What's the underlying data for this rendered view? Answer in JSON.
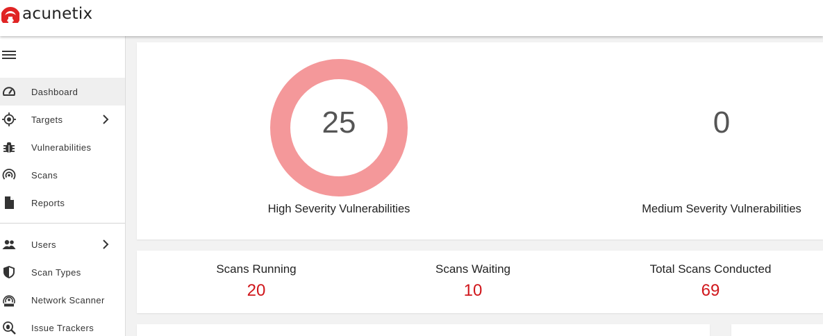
{
  "app": {
    "brand": "acunetix",
    "brand_color": "#e02424"
  },
  "sidebar": {
    "menu_icon": "hamburger-icon",
    "items": [
      {
        "label": "Dashboard",
        "icon": "speedometer-icon",
        "active": true
      },
      {
        "label": "Targets",
        "icon": "crosshair-icon",
        "has_submenu": true
      },
      {
        "label": "Vulnerabilities",
        "icon": "bug-icon"
      },
      {
        "label": "Scans",
        "icon": "radar-icon"
      },
      {
        "label": "Reports",
        "icon": "document-icon"
      },
      {
        "label": "Users",
        "icon": "users-icon",
        "has_submenu": true
      },
      {
        "label": "Scan Types",
        "icon": "shield-icon"
      },
      {
        "label": "Network Scanner",
        "icon": "network-scanner-icon"
      },
      {
        "label": "Issue Trackers",
        "icon": "issue-tracker-icon"
      }
    ]
  },
  "severity": {
    "high": {
      "count": "25",
      "label": "High Severity Vulnerabilities",
      "color": "#f4989a"
    },
    "medium": {
      "count": "0",
      "label": "Medium Severity Vulnerabilities"
    }
  },
  "stats": {
    "running": {
      "label": "Scans Running",
      "value": "20"
    },
    "waiting": {
      "label": "Scans Waiting",
      "value": "10"
    },
    "total": {
      "label": "Total Scans Conducted",
      "value": "69"
    },
    "value_color": "#d0161b"
  }
}
